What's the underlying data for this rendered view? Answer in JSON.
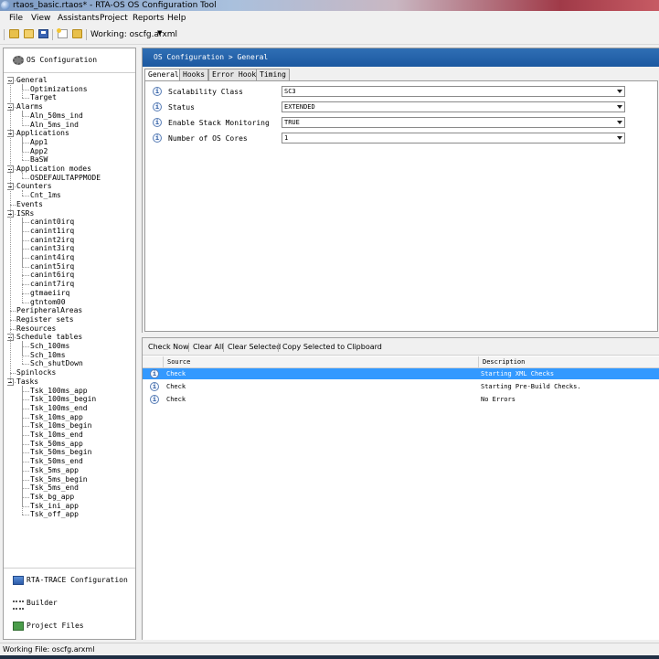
{
  "window": {
    "title": "rtaos_basic.rtaos* - RTA-OS OS Configuration Tool"
  },
  "menu": [
    "File",
    "View",
    "Assistants",
    "Project",
    "Reports",
    "Help"
  ],
  "toolbar": {
    "working_label": "Working: oscfg.arxml",
    "dropdown_glyph": "▼"
  },
  "sidebar": {
    "sections": [
      {
        "label": "OS Configuration",
        "icon": "os-config-icon"
      },
      {
        "label": "RTA-TRACE Configuration",
        "icon": "trace-icon"
      },
      {
        "label": "Builder",
        "icon": "builder-icon"
      },
      {
        "label": "Project Files",
        "icon": "project-files-icon"
      }
    ],
    "tree": [
      {
        "label": "General",
        "level": 0,
        "expandable": true
      },
      {
        "label": "Optimizations",
        "level": 1
      },
      {
        "label": "Target",
        "level": 1
      },
      {
        "label": "Alarms",
        "level": 0,
        "expandable": true
      },
      {
        "label": "Aln_50ms_ind",
        "level": 1
      },
      {
        "label": "Aln_5ms_ind",
        "level": 1
      },
      {
        "label": "Applications",
        "level": 0,
        "expandable": true
      },
      {
        "label": "App1",
        "level": 1
      },
      {
        "label": "App2",
        "level": 1
      },
      {
        "label": "BaSW",
        "level": 1
      },
      {
        "label": "Application modes",
        "level": 0,
        "expandable": true
      },
      {
        "label": "OSDEFAULTAPPMODE",
        "level": 1
      },
      {
        "label": "Counters",
        "level": 0,
        "expandable": true
      },
      {
        "label": "Cnt_1ms",
        "level": 1
      },
      {
        "label": "Events",
        "level": 0
      },
      {
        "label": "ISRs",
        "level": 0,
        "expandable": true
      },
      {
        "label": "canint0irq",
        "level": 1
      },
      {
        "label": "canint1irq",
        "level": 1
      },
      {
        "label": "canint2irq",
        "level": 1
      },
      {
        "label": "canint3irq",
        "level": 1
      },
      {
        "label": "canint4irq",
        "level": 1
      },
      {
        "label": "canint5irq",
        "level": 1
      },
      {
        "label": "canint6irq",
        "level": 1
      },
      {
        "label": "canint7irq",
        "level": 1
      },
      {
        "label": "gtmaeiirq",
        "level": 1
      },
      {
        "label": "gtntom00",
        "level": 1
      },
      {
        "label": "PeripheralAreas",
        "level": 0
      },
      {
        "label": "Register sets",
        "level": 0
      },
      {
        "label": "Resources",
        "level": 0
      },
      {
        "label": "Schedule tables",
        "level": 0,
        "expandable": true
      },
      {
        "label": "Sch_100ms",
        "level": 1
      },
      {
        "label": "Sch_10ms",
        "level": 1
      },
      {
        "label": "Sch_shutDown",
        "level": 1
      },
      {
        "label": "Spinlocks",
        "level": 0
      },
      {
        "label": "Tasks",
        "level": 0,
        "expandable": true
      },
      {
        "label": "Tsk_100ms_app",
        "level": 1
      },
      {
        "label": "Tsk_100ms_begin",
        "level": 1
      },
      {
        "label": "Tsk_100ms_end",
        "level": 1
      },
      {
        "label": "Tsk_10ms_app",
        "level": 1
      },
      {
        "label": "Tsk_10ms_begin",
        "level": 1
      },
      {
        "label": "Tsk_10ms_end",
        "level": 1
      },
      {
        "label": "Tsk_50ms_app",
        "level": 1
      },
      {
        "label": "Tsk_50ms_begin",
        "level": 1
      },
      {
        "label": "Tsk_50ms_end",
        "level": 1
      },
      {
        "label": "Tsk_5ms_app",
        "level": 1
      },
      {
        "label": "Tsk_5ms_begin",
        "level": 1
      },
      {
        "label": "Tsk_5ms_end",
        "level": 1
      },
      {
        "label": "Tsk_bg_app",
        "level": 1
      },
      {
        "label": "Tsk_ini_app",
        "level": 1
      },
      {
        "label": "Tsk_off_app",
        "level": 1
      }
    ]
  },
  "main": {
    "breadcrumb": "OS Configuration > General",
    "tabs": [
      {
        "label": "General",
        "active": true
      },
      {
        "label": "Hooks"
      },
      {
        "label": "Error Hook"
      },
      {
        "label": "Timing"
      }
    ],
    "properties": [
      {
        "label": "Scalability Class",
        "value": "SC3"
      },
      {
        "label": "Status",
        "value": "EXTENDED"
      },
      {
        "label": "Enable Stack Monitoring",
        "value": "TRUE"
      },
      {
        "label": "Number of OS Cores",
        "value": "1"
      }
    ],
    "info_glyph": "i"
  },
  "output": {
    "actions": [
      "Check Now",
      "Clear All",
      "Clear Selected",
      "Copy Selected to Clipboard"
    ],
    "columns": [
      "Source",
      "Description"
    ],
    "rows": [
      {
        "source": "Check",
        "description": "Starting XML Checks",
        "selected": true
      },
      {
        "source": "Check",
        "description": "Starting Pre-Build Checks."
      },
      {
        "source": "Check",
        "description": "No Errors"
      }
    ]
  },
  "status": {
    "text": "Working File: oscfg.arxml"
  },
  "colors": {
    "accent": "#1c58a0",
    "selection": "#3399ff"
  }
}
